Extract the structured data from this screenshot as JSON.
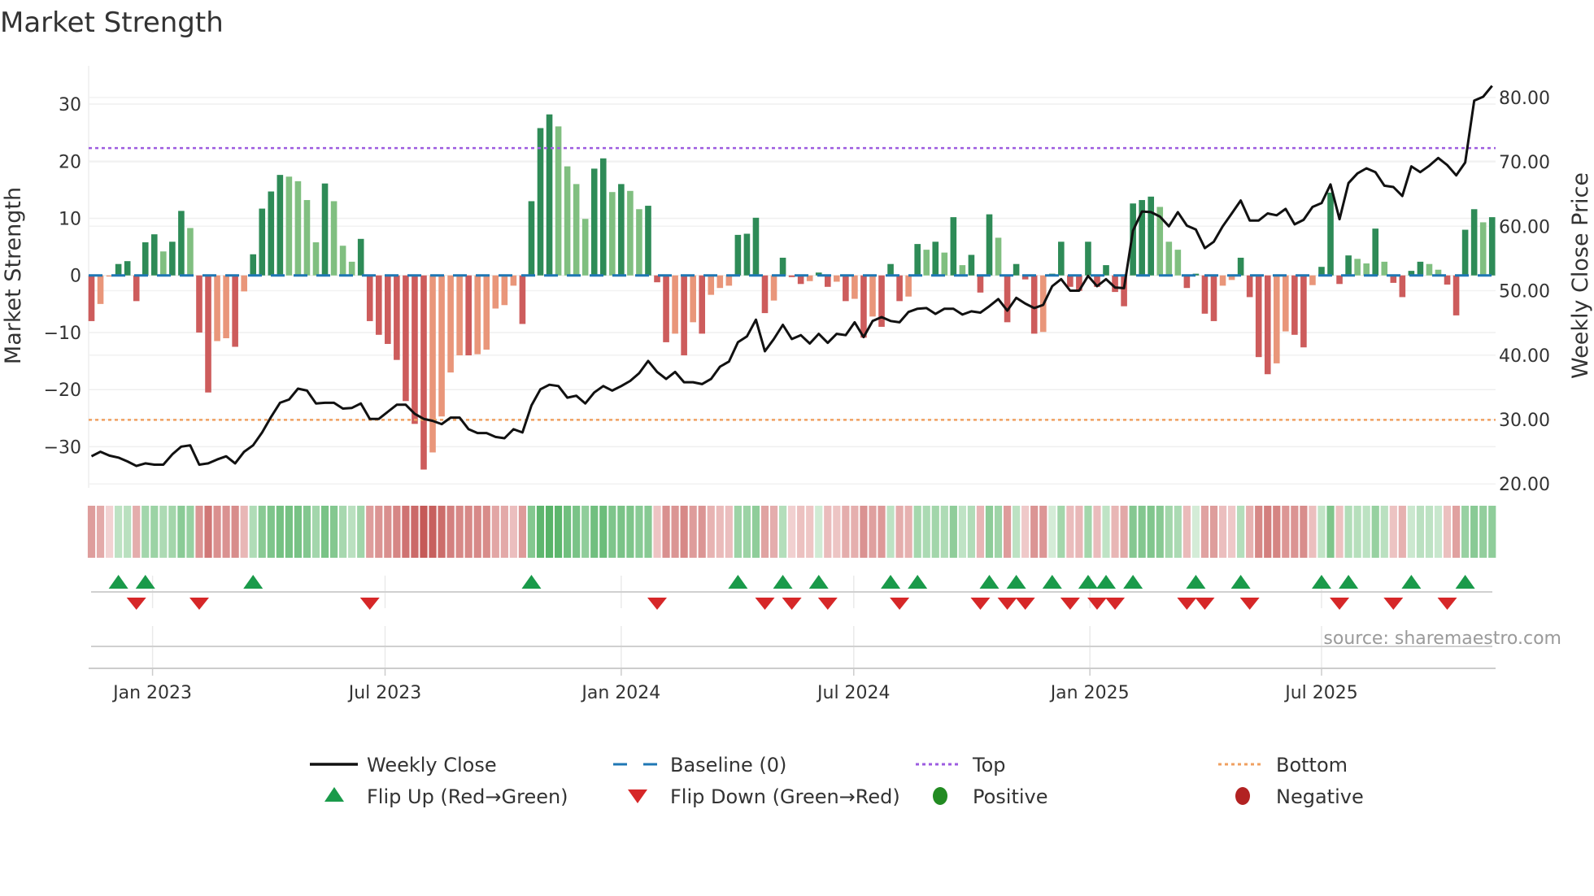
{
  "chart_data": {
    "type": "bar",
    "title": "Market Strength",
    "ylabel": "Market Strength",
    "y2label": "Weekly Close Price",
    "ylim": [
      -37.2,
      36.7
    ],
    "y2lim": [
      19.4,
      84.9
    ],
    "yticks": [
      {
        "v": 30,
        "label": "30"
      },
      {
        "v": 20,
        "label": "20"
      },
      {
        "v": 10,
        "label": "10"
      },
      {
        "v": 0,
        "label": "0"
      },
      {
        "v": -10,
        "label": "−10"
      },
      {
        "v": -20,
        "label": "−20"
      },
      {
        "v": -30,
        "label": "−30"
      }
    ],
    "y2ticks": [
      {
        "v": 80,
        "label": "80.00"
      },
      {
        "v": 70,
        "label": "70.00"
      },
      {
        "v": 60,
        "label": "60.00"
      },
      {
        "v": 50,
        "label": "50.00"
      },
      {
        "v": 40,
        "label": "40.00"
      },
      {
        "v": 30,
        "label": "30.00"
      },
      {
        "v": 20,
        "label": "20.00"
      }
    ],
    "xticks": [
      {
        "week": 6.8,
        "label": "Jan 2023"
      },
      {
        "week": 32.7,
        "label": "Jul 2023"
      },
      {
        "week": 59.0,
        "label": "Jan 2024"
      },
      {
        "week": 84.9,
        "label": "Jul 2024"
      },
      {
        "week": 111.2,
        "label": "Jan 2025"
      },
      {
        "week": 137.0,
        "label": "Jul 2025"
      }
    ],
    "top_level": 22.3,
    "bottom_level": -25.3,
    "baseline": 0,
    "strength": [
      -8,
      -5,
      -0.2,
      2,
      2.5,
      -4.5,
      5.8,
      7.2,
      4.2,
      5.9,
      11.3,
      8.3,
      -10,
      -20.5,
      -11.5,
      -11,
      -12.5,
      -2.8,
      3.7,
      11.7,
      14.7,
      17.6,
      17.3,
      16.5,
      13.2,
      5.8,
      16.1,
      13,
      5.2,
      2.4,
      6.4,
      -8,
      -10.4,
      -12,
      -14.8,
      -22,
      -26,
      -34,
      -31,
      -24.7,
      -17,
      -14,
      -14,
      -13.8,
      -13,
      -5.8,
      -5.2,
      -1.8,
      -8.5,
      13,
      25.8,
      28.2,
      26.1,
      19.1,
      16,
      9.9,
      18.7,
      20.5,
      14.6,
      16,
      14.8,
      11.6,
      12.2,
      -1.2,
      -11.7,
      -10.2,
      -14,
      -8.2,
      -10.2,
      -3.4,
      -2.2,
      -1.8,
      7.1,
      7.3,
      10.1,
      -6.6,
      -4.4,
      3.1,
      -0.3,
      -1.5,
      -1,
      0.5,
      -2,
      -1.1,
      -4.5,
      -4.1,
      -10.9,
      -7.2,
      -9,
      2,
      -4.5,
      -3.7,
      5.5,
      4.5,
      5.9,
      4,
      10.2,
      1.8,
      3.6,
      -3,
      10.7,
      6.6,
      -8.2,
      2,
      -0.7,
      -10.2,
      -9.9,
      0.3,
      5.9,
      -2,
      -2.7,
      5.9,
      -2,
      1.8,
      -2.9,
      -5.4,
      12.6,
      13.2,
      13.8,
      12,
      5.9,
      4.5,
      -2.2,
      0.3,
      -6.7,
      -8,
      -1.8,
      -0.8,
      3.1,
      -3.8,
      -14.3,
      -17.3,
      -15.4,
      -9.8,
      -10.4,
      -12.6,
      -1.7,
      1.5,
      14.5,
      -1.5,
      3.5,
      2.9,
      2.1,
      8.2,
      2.4,
      -1.3,
      -3.8,
      0.8,
      2.4,
      2,
      1,
      -1.6,
      -7,
      8,
      11.6,
      9.3,
      10.2
    ],
    "weekly_close": [
      24.3,
      25.0,
      24.4,
      24.1,
      23.5,
      22.8,
      23.2,
      23.0,
      23.0,
      24.6,
      25.8,
      26.0,
      23.0,
      23.2,
      23.8,
      24.3,
      23.2,
      25.0,
      26.0,
      28.0,
      30.4,
      32.6,
      33.1,
      34.8,
      34.5,
      32.5,
      32.6,
      32.6,
      31.7,
      31.8,
      32.5,
      30.1,
      30.1,
      31.2,
      32.3,
      32.3,
      30.9,
      30.1,
      29.8,
      29.3,
      30.3,
      30.3,
      28.5,
      27.9,
      27.9,
      27.3,
      27.1,
      28.5,
      28.0,
      32.2,
      34.7,
      35.4,
      35.2,
      33.4,
      33.7,
      32.5,
      34.2,
      35.2,
      34.5,
      35.2,
      36.0,
      37.2,
      39.1,
      37.4,
      36.3,
      37.4,
      35.8,
      35.8,
      35.5,
      36.3,
      38.2,
      39.0,
      42.0,
      42.9,
      45.5,
      40.6,
      42.5,
      44.7,
      42.5,
      43.1,
      41.8,
      43.3,
      41.9,
      43.3,
      43.1,
      45.1,
      42.8,
      45.3,
      45.9,
      45.3,
      45.1,
      46.7,
      47.2,
      47.3,
      46.4,
      47.2,
      47.2,
      46.3,
      46.8,
      46.6,
      47.6,
      48.7,
      46.9,
      48.9,
      48.0,
      47.3,
      47.8,
      50.7,
      51.8,
      50.0,
      50.0,
      52.3,
      50.7,
      51.8,
      50.5,
      50.4,
      59.3,
      62.3,
      62.2,
      61.5,
      60.0,
      62.2,
      60.1,
      59.5,
      56.6,
      57.6,
      60.0,
      62.0,
      64.0,
      60.9,
      60.9,
      62.0,
      61.7,
      62.7,
      60.3,
      61.0,
      63.0,
      63.6,
      66.5,
      61.1,
      66.7,
      68.2,
      69.0,
      68.4,
      66.3,
      66.1,
      64.7,
      69.3,
      68.4,
      69.4,
      70.6,
      69.5,
      67.9,
      69.9,
      79.5,
      80.1,
      81.8
    ],
    "colors": {
      "pos_rising": "#2e8b57",
      "pos_falling": "#80bf80",
      "neg_falling": "#cd5c5c",
      "neg_rising": "#e9967a",
      "baseline": "#1f77b4",
      "top": "#9d5ce0",
      "bottom": "#f0a060",
      "close": "#111111",
      "flip_up": "#1a9a4a",
      "flip_down": "#d62728",
      "positive": "#228b22",
      "negative": "#b22222"
    },
    "legend": [
      {
        "key": "close",
        "label": "Weekly Close",
        "symbol": "line"
      },
      {
        "key": "baseline",
        "label": "Baseline (0)",
        "symbol": "dash"
      },
      {
        "key": "top",
        "label": "Top",
        "symbol": "dot"
      },
      {
        "key": "bottom",
        "label": "Bottom",
        "symbol": "dot"
      },
      {
        "key": "flip_up",
        "label": "Flip Up (Red→Green)",
        "symbol": "tri-up"
      },
      {
        "key": "flip_down",
        "label": "Flip Down (Green→Red)",
        "symbol": "tri-down"
      },
      {
        "key": "positive",
        "label": "Positive",
        "symbol": "circle"
      },
      {
        "key": "negative",
        "label": "Negative",
        "symbol": "circle"
      }
    ],
    "source": "source: sharemaestro.com"
  }
}
